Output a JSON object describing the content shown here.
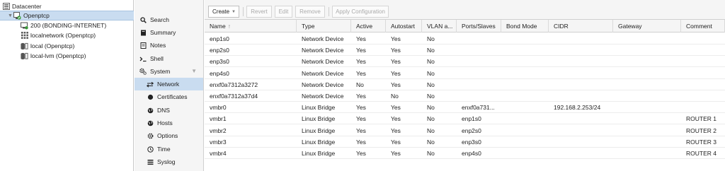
{
  "tree": {
    "datacenter": "Datacenter",
    "node": "Openptcp",
    "children": [
      {
        "label": "200 (BONDING-INTERNET)",
        "icon": "vm-running-icon"
      },
      {
        "label": "localnetwork (Openptcp)",
        "icon": "sdn-grid-icon"
      },
      {
        "label": "local (Openptcp)",
        "icon": "storage-icon"
      },
      {
        "label": "local-lvm (Openptcp)",
        "icon": "storage-icon"
      }
    ]
  },
  "menu": {
    "items": [
      {
        "label": "Search",
        "icon": "search-icon"
      },
      {
        "label": "Summary",
        "icon": "book-icon"
      },
      {
        "label": "Notes",
        "icon": "notes-icon"
      },
      {
        "label": "Shell",
        "icon": "terminal-icon"
      },
      {
        "label": "System",
        "icon": "gears-icon"
      },
      {
        "label": "Network",
        "icon": "exchange-icon"
      },
      {
        "label": "Certificates",
        "icon": "certificate-icon"
      },
      {
        "label": "DNS",
        "icon": "globe-icon"
      },
      {
        "label": "Hosts",
        "icon": "globe-icon"
      },
      {
        "label": "Options",
        "icon": "gear-icon"
      },
      {
        "label": "Time",
        "icon": "clock-icon"
      },
      {
        "label": "Syslog",
        "icon": "list-icon"
      }
    ]
  },
  "toolbar": {
    "create": "Create",
    "revert": "Revert",
    "edit": "Edit",
    "remove": "Remove",
    "apply": "Apply Configuration"
  },
  "grid": {
    "columns": [
      "Name",
      "Type",
      "Active",
      "Autostart",
      "VLAN a...",
      "Ports/Slaves",
      "Bond Mode",
      "CIDR",
      "Gateway",
      "Comment"
    ],
    "sort_indicator": "↑",
    "rows": [
      [
        "enp1s0",
        "Network Device",
        "Yes",
        "Yes",
        "No",
        "",
        "",
        "",
        "",
        ""
      ],
      [
        "enp2s0",
        "Network Device",
        "Yes",
        "Yes",
        "No",
        "",
        "",
        "",
        "",
        ""
      ],
      [
        "enp3s0",
        "Network Device",
        "Yes",
        "Yes",
        "No",
        "",
        "",
        "",
        "",
        ""
      ],
      [
        "enp4s0",
        "Network Device",
        "Yes",
        "Yes",
        "No",
        "",
        "",
        "",
        "",
        ""
      ],
      [
        "enxf0a7312a3272",
        "Network Device",
        "No",
        "Yes",
        "No",
        "",
        "",
        "",
        "",
        ""
      ],
      [
        "enxf0a7312a37d4",
        "Network Device",
        "Yes",
        "No",
        "No",
        "",
        "",
        "",
        "",
        ""
      ],
      [
        "vmbr0",
        "Linux Bridge",
        "Yes",
        "Yes",
        "No",
        "enxf0a731...",
        "",
        "192.168.2.253/24",
        "",
        ""
      ],
      [
        "vmbr1",
        "Linux Bridge",
        "Yes",
        "Yes",
        "No",
        "enp1s0",
        "",
        "",
        "",
        "ROUTER 1"
      ],
      [
        "vmbr2",
        "Linux Bridge",
        "Yes",
        "Yes",
        "No",
        "enp2s0",
        "",
        "",
        "",
        "ROUTER 2"
      ],
      [
        "vmbr3",
        "Linux Bridge",
        "Yes",
        "Yes",
        "No",
        "enp3s0",
        "",
        "",
        "",
        "ROUTER 3"
      ],
      [
        "vmbr4",
        "Linux Bridge",
        "Yes",
        "Yes",
        "No",
        "enp4s0",
        "",
        "",
        "",
        "ROUTER 4"
      ]
    ]
  },
  "colors": {
    "selection": "#c9dcf0",
    "panel_bg": "#f5f5f5",
    "node_online": "#3a9a3a"
  }
}
